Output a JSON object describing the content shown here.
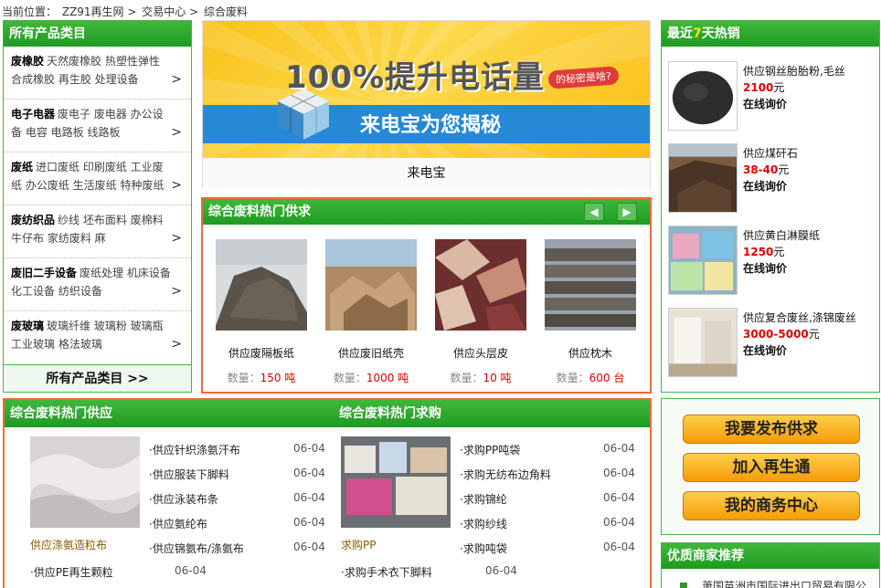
{
  "breadcrumb": {
    "prefix": "当前位置：",
    "items": [
      "ZZ91再生网",
      "交易中心",
      "综合废料"
    ],
    "sep": ">"
  },
  "categories": {
    "title": "所有产品类目",
    "items": [
      {
        "name": "废橡胶",
        "subs": "天然废橡胶 热塑性弹性 合成橡胶 再生胶 处理设备"
      },
      {
        "name": "电子电器",
        "subs": "废电子 废电器 办公设备 电容 电路板 线路板"
      },
      {
        "name": "废纸",
        "subs": "进口废纸 印刷废纸 工业废纸 办公废纸 生活废纸 特种废纸"
      },
      {
        "name": "废纺织品",
        "subs": "纱线 坯布面料 废棉料 牛仔布 家纺废料 麻"
      },
      {
        "name": "废旧二手设备",
        "subs": "废纸处理 机床设备 化工设备 纺织设备"
      },
      {
        "name": "废玻璃",
        "subs": "玻璃纤维 玻璃粉 玻璃瓶 工业玻璃 格法玻璃"
      }
    ],
    "arrow": ">",
    "all_label": "所有产品类目 >>"
  },
  "banner": {
    "headline": "100%提升电话量",
    "tag": "的秘密是啥?",
    "sub": "来电宝为您揭秘",
    "caption": "来电宝"
  },
  "hot_supply": {
    "title": "综合废料热门供求",
    "prev": "◀",
    "next": "▶",
    "items": [
      {
        "title": "供应废隔板纸",
        "qty_label": "数量：",
        "qty": "150 吨"
      },
      {
        "title": "供应废旧纸壳",
        "qty_label": "数量：",
        "qty": "1000 吨"
      },
      {
        "title": "供应头层皮",
        "qty_label": "数量：",
        "qty": "10 吨"
      },
      {
        "title": "供应枕木",
        "qty_label": "数量：",
        "qty": "600 台"
      }
    ]
  },
  "best_sellers": {
    "title_pre": "最近",
    "title_num": "7",
    "title_post": "天热销",
    "items": [
      {
        "name": "供应钢丝胎胎粉,毛丝",
        "price": "2100",
        "unit": "元",
        "ask": "在线询价"
      },
      {
        "name": "供应煤矸石",
        "price": "38-40",
        "unit": "元",
        "ask": "在线询价"
      },
      {
        "name": "供应黄白淋膜纸",
        "price": "1250",
        "unit": "元",
        "ask": "在线询价"
      },
      {
        "name": "供应复合废丝,涤锦废丝",
        "price": "3000-5000",
        "unit": "元",
        "ask": "在线询价"
      }
    ]
  },
  "supply": {
    "title": "综合废料热门供应",
    "image_caption": "供应涤氨造粒布",
    "rows": [
      {
        "label": "·供应针织涤氨汗布",
        "date": "06-04"
      },
      {
        "label": "·供应服装下脚料",
        "date": "06-04"
      },
      {
        "label": "·供应泳装布条",
        "date": "06-04"
      },
      {
        "label": "·供应氨纶布",
        "date": "06-04"
      },
      {
        "label": "·供应锦氨布/涤氨布",
        "date": "06-04"
      }
    ],
    "extra_row": {
      "label": "·供应PE再生颗粒",
      "date": "06-04"
    }
  },
  "demand": {
    "title": "综合废料热门求购",
    "image_caption": "求购PP",
    "rows": [
      {
        "label": "·求购PP吨袋",
        "date": "06-04"
      },
      {
        "label": "·求购无纺布边角料",
        "date": "06-04"
      },
      {
        "label": "·求购锦纶",
        "date": "06-04"
      },
      {
        "label": "·求购纱线",
        "date": "06-04"
      },
      {
        "label": "·求购吨袋",
        "date": "06-04"
      }
    ],
    "extra_row": {
      "label": "·求购手术衣下脚料",
      "date": "06-04"
    }
  },
  "actions": {
    "publish": "我要发布供求",
    "join": "加入再生通",
    "center": "我的商务中心"
  },
  "merchants": {
    "title": "优质商家推荐",
    "first": "萧国苗洲市国际进出口贸易有限公"
  },
  "colors": {
    "green": "#2a9e2a",
    "orange_border": "#f06a3a",
    "price_red": "#dd0000",
    "button_orange": "#f5a011"
  }
}
